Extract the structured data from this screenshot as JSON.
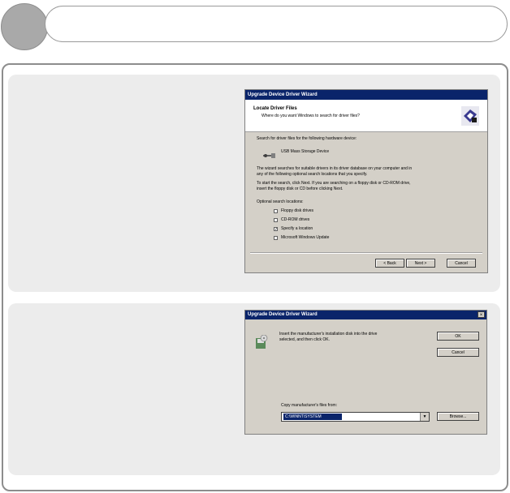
{
  "wizard1": {
    "title": "Upgrade Device Driver Wizard",
    "header_title": "Locate Driver Files",
    "header_subtitle": "Where do you want Windows to search for driver files?",
    "search_text": "Search for driver files for the following hardware device:",
    "device_name": "USB Mass Storage Device",
    "para1_line1": "The wizard searches for suitable drivers in its driver database on your computer and in",
    "para1_line2": "any of the following optional search locations that you specify.",
    "para2_line1": "To start the search, click Next. If you are searching on a floppy disk or CD-ROM drive,",
    "para2_line2": "insert the floppy disk or CD before clicking Next.",
    "optional_label": "Optional search locations:",
    "options": [
      {
        "label": "Floppy disk drives",
        "checked": ""
      },
      {
        "label": "CD-ROM drives",
        "checked": ""
      },
      {
        "label": "Specify a location",
        "checked": "✓"
      },
      {
        "label": "Microsoft Windows Update",
        "checked": ""
      }
    ],
    "back_button": "< Back",
    "next_button": "Next >",
    "cancel_button": "Cancel"
  },
  "wizard2": {
    "title": "Upgrade Device Driver Wizard",
    "close": "×",
    "message_line1": "Insert the manufacturer's installation disk into the drive",
    "message_line2": "selected, and then click OK.",
    "ok_button": "OK",
    "cancel_button": "Cancel",
    "copy_label": "Copy manufacturer's files from:",
    "path_value": "C:\\WINNT\\SYSTEM",
    "browse_button": "Browse..."
  }
}
